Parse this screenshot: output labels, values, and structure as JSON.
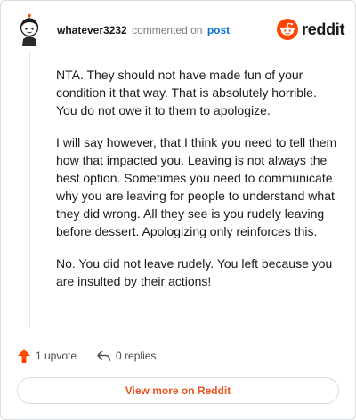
{
  "header": {
    "username": "whatever3232",
    "verb": "commented on",
    "post_link": "post",
    "brand": "reddit",
    "brand_color": "#ff4500"
  },
  "comment": {
    "paragraphs": [
      "NTA. They should not have made fun of your condition it that way. That is absolutely horrible. You do not owe it to them to apologize.",
      "I will say however, that I think you need to tell them how that impacted you. Leaving is not always the best option. Sometimes you need to communicate why you are leaving for people to understand what they did wrong. All they see is you rudely leaving before dessert. Apologizing only reinforces this.",
      "No. You did not leave rudely. You left because you are insulted by their actions!"
    ]
  },
  "footer": {
    "upvote_label": "1 upvote",
    "replies_label": "0 replies",
    "upvote_icon": "arrow-up-icon",
    "reply_icon": "reply-arrow-icon"
  },
  "view_more_label": "View more on Reddit",
  "accent_color": "#e8551e"
}
